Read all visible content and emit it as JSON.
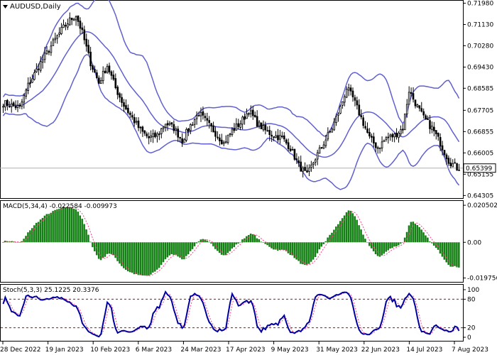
{
  "chart_data": {
    "type": "candlestick",
    "symbol_title": "AUDUSD,Daily",
    "price": {
      "yticks": [
        "0.71980",
        "0.71130",
        "0.70280",
        "0.69430",
        "0.68585",
        "0.67705",
        "0.66855",
        "0.66005",
        "0.65155",
        "0.64305"
      ],
      "current_price": "0.65399",
      "ylim": [
        0.6423,
        0.7205
      ],
      "bands_desc": "Bollinger Bands"
    },
    "macd": {
      "label": "MACD(5,34,4) -0.022584 -0.009973",
      "yticks": [
        "0.020502",
        "0.00",
        "-0.019756"
      ],
      "ylim": [
        -0.0215,
        0.0225
      ]
    },
    "stoch": {
      "label": "Stoch(5,3,3) 25.1225 20.3376",
      "yticks": [
        "100",
        "80",
        "20",
        "0"
      ],
      "levels": [
        80,
        20
      ]
    },
    "xticks": [
      "28 Dec 2022",
      "19 Jan 2023",
      "10 Feb 2023",
      "6 Mar 2023",
      "24 Mar 2023",
      "17 Apr 2023",
      "9 May 2023",
      "31 May 2023",
      "22 Jun 2023",
      "14 Jul 2023",
      "7 Aug 2023"
    ],
    "colors": {
      "band": "#6060d0",
      "candle": "#000000",
      "macd_bar": "#128012",
      "macd_signal": "#ff4080",
      "stoch_main": "#0000a0",
      "stoch_signal": "#ff4080",
      "level_line": "#c00000",
      "axis": "#000000"
    },
    "price_anchors": [
      [
        0,
        0.68
      ],
      [
        8,
        0.678
      ],
      [
        12,
        0.687
      ],
      [
        18,
        0.696
      ],
      [
        24,
        0.704
      ],
      [
        28,
        0.709
      ],
      [
        32,
        0.713
      ],
      [
        35,
        0.715
      ],
      [
        38,
        0.708
      ],
      [
        42,
        0.696
      ],
      [
        46,
        0.688
      ],
      [
        50,
        0.695
      ],
      [
        54,
        0.686
      ],
      [
        58,
        0.679
      ],
      [
        62,
        0.674
      ],
      [
        66,
        0.669
      ],
      [
        70,
        0.666
      ],
      [
        74,
        0.667
      ],
      [
        78,
        0.672
      ],
      [
        82,
        0.67
      ],
      [
        86,
        0.665
      ],
      [
        90,
        0.671
      ],
      [
        94,
        0.676
      ],
      [
        98,
        0.672
      ],
      [
        102,
        0.668
      ],
      [
        106,
        0.664
      ],
      [
        110,
        0.669
      ],
      [
        114,
        0.672
      ],
      [
        118,
        0.677
      ],
      [
        122,
        0.672
      ],
      [
        126,
        0.669
      ],
      [
        130,
        0.667
      ],
      [
        134,
        0.666
      ],
      [
        138,
        0.662
      ],
      [
        142,
        0.655
      ],
      [
        146,
        0.651
      ],
      [
        150,
        0.658
      ],
      [
        154,
        0.664
      ],
      [
        158,
        0.67
      ],
      [
        162,
        0.678
      ],
      [
        165,
        0.686
      ],
      [
        168,
        0.682
      ],
      [
        172,
        0.674
      ],
      [
        176,
        0.666
      ],
      [
        180,
        0.662
      ],
      [
        184,
        0.666
      ],
      [
        188,
        0.667
      ],
      [
        192,
        0.67
      ],
      [
        195,
        0.685
      ],
      [
        198,
        0.68
      ],
      [
        202,
        0.674
      ],
      [
        206,
        0.67
      ],
      [
        210,
        0.664
      ],
      [
        214,
        0.657
      ],
      [
        218,
        0.654
      ]
    ]
  }
}
